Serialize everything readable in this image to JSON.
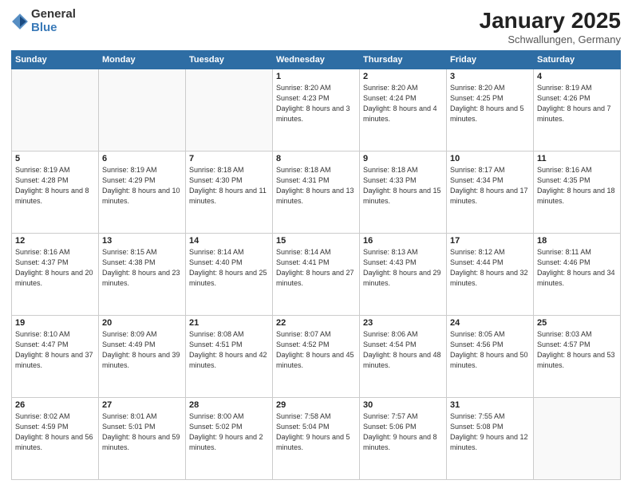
{
  "logo": {
    "general": "General",
    "blue": "Blue"
  },
  "header": {
    "title": "January 2025",
    "subtitle": "Schwallungen, Germany"
  },
  "days_of_week": [
    "Sunday",
    "Monday",
    "Tuesday",
    "Wednesday",
    "Thursday",
    "Friday",
    "Saturday"
  ],
  "weeks": [
    [
      {
        "day": "",
        "info": ""
      },
      {
        "day": "",
        "info": ""
      },
      {
        "day": "",
        "info": ""
      },
      {
        "day": "1",
        "info": "Sunrise: 8:20 AM\nSunset: 4:23 PM\nDaylight: 8 hours and 3 minutes."
      },
      {
        "day": "2",
        "info": "Sunrise: 8:20 AM\nSunset: 4:24 PM\nDaylight: 8 hours and 4 minutes."
      },
      {
        "day": "3",
        "info": "Sunrise: 8:20 AM\nSunset: 4:25 PM\nDaylight: 8 hours and 5 minutes."
      },
      {
        "day": "4",
        "info": "Sunrise: 8:19 AM\nSunset: 4:26 PM\nDaylight: 8 hours and 7 minutes."
      }
    ],
    [
      {
        "day": "5",
        "info": "Sunrise: 8:19 AM\nSunset: 4:28 PM\nDaylight: 8 hours and 8 minutes."
      },
      {
        "day": "6",
        "info": "Sunrise: 8:19 AM\nSunset: 4:29 PM\nDaylight: 8 hours and 10 minutes."
      },
      {
        "day": "7",
        "info": "Sunrise: 8:18 AM\nSunset: 4:30 PM\nDaylight: 8 hours and 11 minutes."
      },
      {
        "day": "8",
        "info": "Sunrise: 8:18 AM\nSunset: 4:31 PM\nDaylight: 8 hours and 13 minutes."
      },
      {
        "day": "9",
        "info": "Sunrise: 8:18 AM\nSunset: 4:33 PM\nDaylight: 8 hours and 15 minutes."
      },
      {
        "day": "10",
        "info": "Sunrise: 8:17 AM\nSunset: 4:34 PM\nDaylight: 8 hours and 17 minutes."
      },
      {
        "day": "11",
        "info": "Sunrise: 8:16 AM\nSunset: 4:35 PM\nDaylight: 8 hours and 18 minutes."
      }
    ],
    [
      {
        "day": "12",
        "info": "Sunrise: 8:16 AM\nSunset: 4:37 PM\nDaylight: 8 hours and 20 minutes."
      },
      {
        "day": "13",
        "info": "Sunrise: 8:15 AM\nSunset: 4:38 PM\nDaylight: 8 hours and 23 minutes."
      },
      {
        "day": "14",
        "info": "Sunrise: 8:14 AM\nSunset: 4:40 PM\nDaylight: 8 hours and 25 minutes."
      },
      {
        "day": "15",
        "info": "Sunrise: 8:14 AM\nSunset: 4:41 PM\nDaylight: 8 hours and 27 minutes."
      },
      {
        "day": "16",
        "info": "Sunrise: 8:13 AM\nSunset: 4:43 PM\nDaylight: 8 hours and 29 minutes."
      },
      {
        "day": "17",
        "info": "Sunrise: 8:12 AM\nSunset: 4:44 PM\nDaylight: 8 hours and 32 minutes."
      },
      {
        "day": "18",
        "info": "Sunrise: 8:11 AM\nSunset: 4:46 PM\nDaylight: 8 hours and 34 minutes."
      }
    ],
    [
      {
        "day": "19",
        "info": "Sunrise: 8:10 AM\nSunset: 4:47 PM\nDaylight: 8 hours and 37 minutes."
      },
      {
        "day": "20",
        "info": "Sunrise: 8:09 AM\nSunset: 4:49 PM\nDaylight: 8 hours and 39 minutes."
      },
      {
        "day": "21",
        "info": "Sunrise: 8:08 AM\nSunset: 4:51 PM\nDaylight: 8 hours and 42 minutes."
      },
      {
        "day": "22",
        "info": "Sunrise: 8:07 AM\nSunset: 4:52 PM\nDaylight: 8 hours and 45 minutes."
      },
      {
        "day": "23",
        "info": "Sunrise: 8:06 AM\nSunset: 4:54 PM\nDaylight: 8 hours and 48 minutes."
      },
      {
        "day": "24",
        "info": "Sunrise: 8:05 AM\nSunset: 4:56 PM\nDaylight: 8 hours and 50 minutes."
      },
      {
        "day": "25",
        "info": "Sunrise: 8:03 AM\nSunset: 4:57 PM\nDaylight: 8 hours and 53 minutes."
      }
    ],
    [
      {
        "day": "26",
        "info": "Sunrise: 8:02 AM\nSunset: 4:59 PM\nDaylight: 8 hours and 56 minutes."
      },
      {
        "day": "27",
        "info": "Sunrise: 8:01 AM\nSunset: 5:01 PM\nDaylight: 8 hours and 59 minutes."
      },
      {
        "day": "28",
        "info": "Sunrise: 8:00 AM\nSunset: 5:02 PM\nDaylight: 9 hours and 2 minutes."
      },
      {
        "day": "29",
        "info": "Sunrise: 7:58 AM\nSunset: 5:04 PM\nDaylight: 9 hours and 5 minutes."
      },
      {
        "day": "30",
        "info": "Sunrise: 7:57 AM\nSunset: 5:06 PM\nDaylight: 9 hours and 8 minutes."
      },
      {
        "day": "31",
        "info": "Sunrise: 7:55 AM\nSunset: 5:08 PM\nDaylight: 9 hours and 12 minutes."
      },
      {
        "day": "",
        "info": ""
      }
    ]
  ]
}
